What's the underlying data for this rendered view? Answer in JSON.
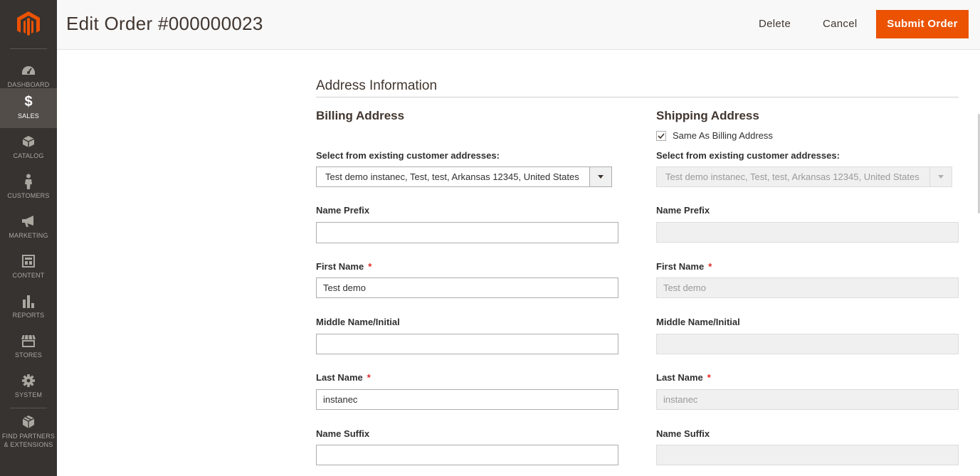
{
  "sidebar": {
    "items": [
      {
        "label": "DASHBOARD",
        "icon": "dashboard-icon"
      },
      {
        "label": "SALES",
        "icon": "dollar-icon"
      },
      {
        "label": "CATALOG",
        "icon": "cube-icon"
      },
      {
        "label": "CUSTOMERS",
        "icon": "person-icon"
      },
      {
        "label": "MARKETING",
        "icon": "megaphone-icon"
      },
      {
        "label": "CONTENT",
        "icon": "layout-icon"
      },
      {
        "label": "REPORTS",
        "icon": "bar-chart-icon"
      },
      {
        "label": "STORES",
        "icon": "storefront-icon"
      },
      {
        "label": "SYSTEM",
        "icon": "gear-icon"
      },
      {
        "label": "FIND PARTNERS & EXTENSIONS",
        "icon": "boxes-icon"
      }
    ],
    "active": "SALES",
    "colors": {
      "bg": "#373330",
      "active_bg": "#524d49",
      "logo": "#eb5202"
    }
  },
  "header": {
    "title": "Edit Order #000000023",
    "delete_label": "Delete",
    "cancel_label": "Cancel",
    "submit_label": "Submit Order",
    "accent": "#eb5202"
  },
  "section": {
    "title": "Address Information"
  },
  "billing": {
    "title": "Billing Address",
    "select_label": "Select from existing customer addresses:",
    "select_value": "Test demo instanec, Test, test, Arkansas 12345, United States",
    "name_prefix_label": "Name Prefix",
    "name_prefix_value": "",
    "first_name_label": "First Name",
    "first_name_value": "Test demo",
    "middle_name_label": "Middle Name/Initial",
    "middle_name_value": "",
    "last_name_label": "Last Name",
    "last_name_value": "instanec",
    "name_suffix_label": "Name Suffix",
    "name_suffix_value": ""
  },
  "shipping": {
    "title": "Shipping Address",
    "same_as_billing_label": "Same As Billing Address",
    "same_as_billing_checked": true,
    "select_label": "Select from existing customer addresses:",
    "select_value": "Test demo instanec, Test, test, Arkansas 12345, United States",
    "name_prefix_label": "Name Prefix",
    "name_prefix_value": "",
    "first_name_label": "First Name",
    "first_name_value": "Test demo",
    "middle_name_label": "Middle Name/Initial",
    "middle_name_value": "",
    "last_name_label": "Last Name",
    "last_name_value": "instanec",
    "name_suffix_label": "Name Suffix",
    "name_suffix_value": ""
  },
  "required_marker": "*"
}
